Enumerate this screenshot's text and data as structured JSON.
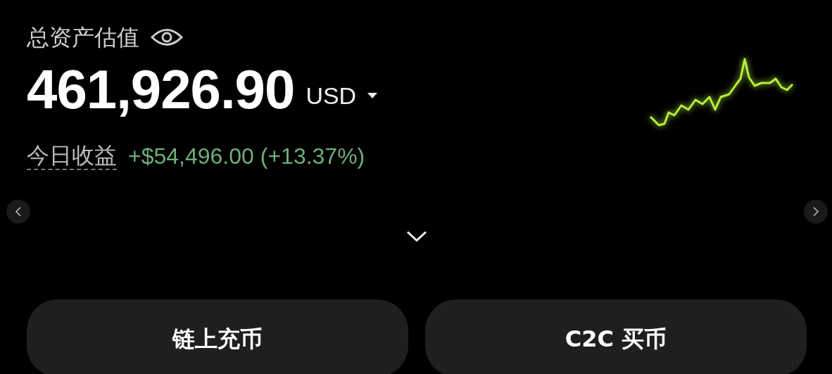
{
  "header": {
    "title": "总资产估值"
  },
  "balance": {
    "amount": "461,926.90",
    "currency": "USD"
  },
  "today": {
    "label": "今日收益",
    "change": "+$54,496.00 (+13.37%)"
  },
  "buttons": [
    {
      "label": "链上充币"
    },
    {
      "label": "C2C 买币"
    }
  ]
}
